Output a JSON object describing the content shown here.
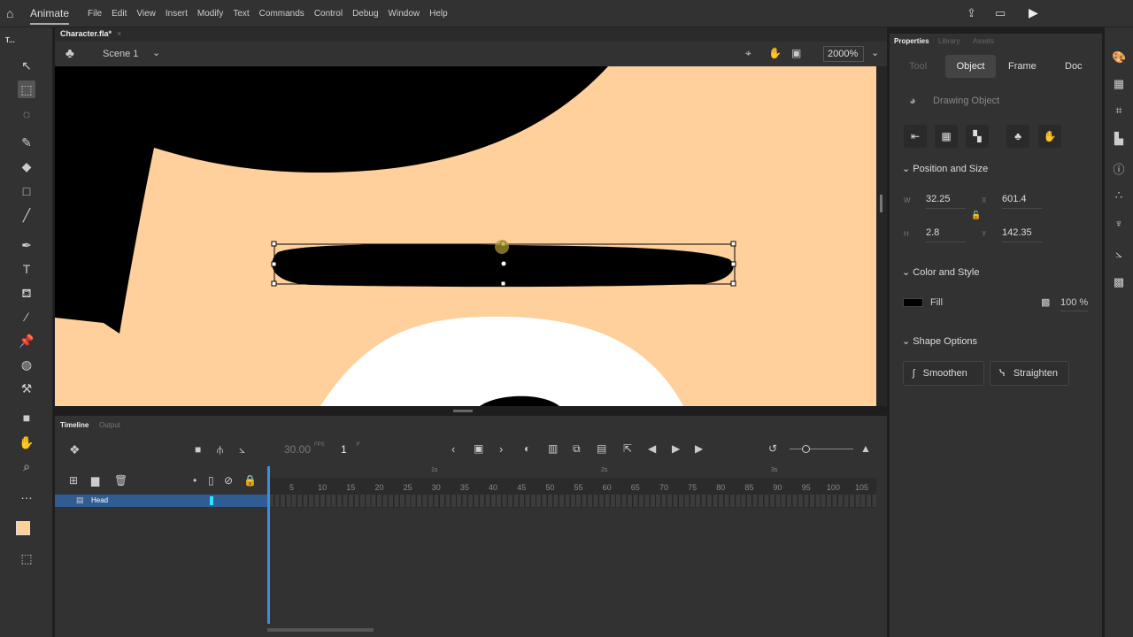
{
  "app": {
    "name": "Animate",
    "menus": [
      "File",
      "Edit",
      "View",
      "Insert",
      "Modify",
      "Text",
      "Commands",
      "Control",
      "Debug",
      "Window",
      "Help"
    ]
  },
  "document": {
    "tab": "Character.fla*",
    "scene": "Scene 1",
    "zoom": "2000%"
  },
  "toolbar": {
    "title": "T..."
  },
  "colors": {
    "skin": "#ffd09b",
    "hair": "#000000",
    "eye_white": "#ffffff",
    "selection_blue": "#2f5c93",
    "fill": "#000000",
    "fill_swatch": "#ffcf99"
  },
  "timeline": {
    "tabs": [
      "Timeline",
      "Output"
    ],
    "fps": "30.00",
    "fps_unit": "FPS",
    "frame": "1",
    "frame_unit": "F",
    "frame_numbers": [
      5,
      10,
      15,
      20,
      25,
      30,
      35,
      40,
      45,
      50,
      55,
      60,
      65,
      70,
      75,
      80,
      85,
      90,
      95,
      100,
      105
    ],
    "seconds": [
      "1s",
      "2s",
      "3s"
    ],
    "layers": [
      {
        "name": "Head",
        "selected": true
      }
    ]
  },
  "properties": {
    "tabs": [
      "Properties",
      "Library",
      "Assets"
    ],
    "subtabs": [
      "Tool",
      "Object",
      "Frame",
      "Doc"
    ],
    "active_subtab": "Object",
    "object_type": "Drawing Object",
    "position_size": {
      "title": "Position and Size",
      "w_label": "W",
      "w": "32.25",
      "h_label": "H",
      "h": "2.8",
      "x_label": "X",
      "x": "601.4",
      "y_label": "Y",
      "y": "142.35"
    },
    "color_style": {
      "title": "Color and Style",
      "fill_label": "Fill",
      "alpha": "100 %"
    },
    "shape_options": {
      "title": "Shape Options",
      "smoothen": "Smoothen",
      "straighten": "Straighten"
    }
  }
}
